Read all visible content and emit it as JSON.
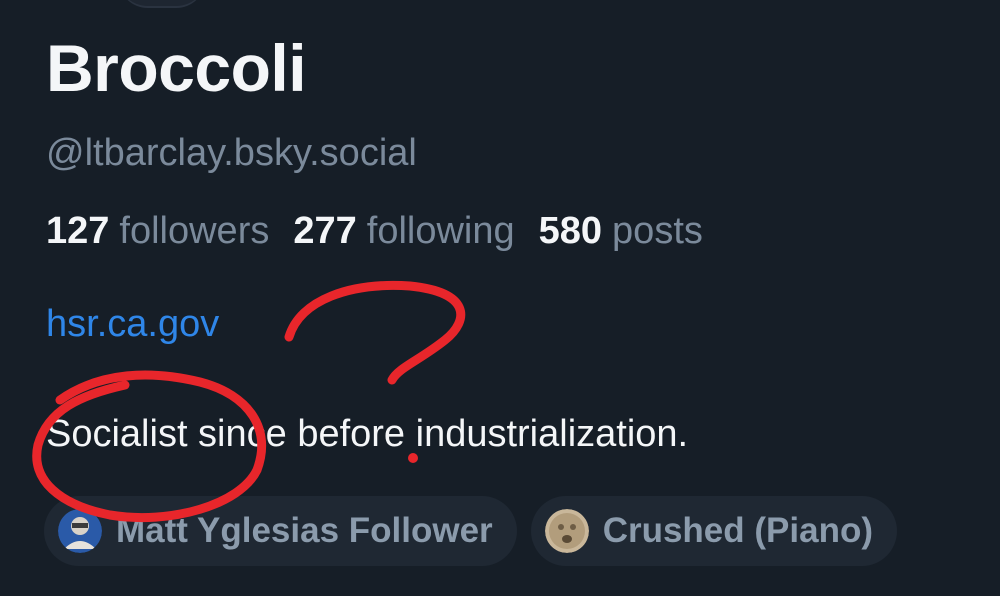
{
  "profile": {
    "display_name": "Broccoli",
    "handle": "@ltbarclay.bsky.social",
    "website": "hsr.ca.gov",
    "bio": "Socialist since before industrialization."
  },
  "stats": {
    "followers_count": "127",
    "followers_label": "followers",
    "following_count": "277",
    "following_label": "following",
    "posts_count": "580",
    "posts_label": "posts"
  },
  "badges": [
    {
      "label": "Matt Yglesias Follower",
      "icon": "portrait-avatar-icon"
    },
    {
      "label": "Crushed (Piano)",
      "icon": "stone-face-icon"
    }
  ],
  "annotation": {
    "color": "#e8262b",
    "marks": [
      "question-mark",
      "circle-around-socialist"
    ]
  },
  "colors": {
    "background": "#161e27",
    "link": "#2f86e8",
    "muted_text": "#7b8a9b",
    "badge_background": "#1f2833"
  }
}
